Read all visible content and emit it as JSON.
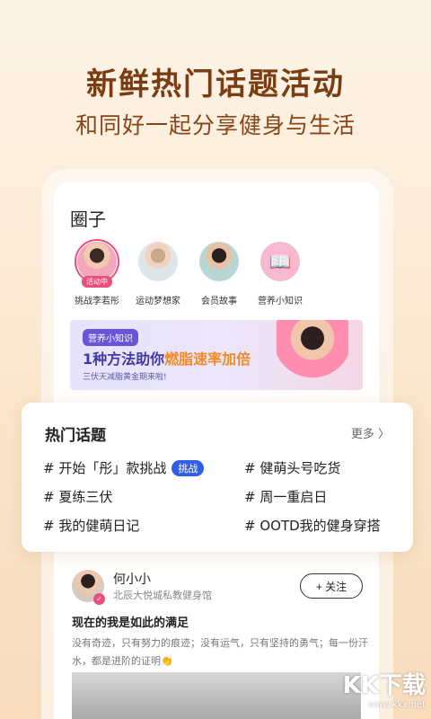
{
  "header": {
    "headline": "新鲜热门话题活动",
    "subline": "和同好一起分享健身与生活"
  },
  "circles": {
    "title": "圈子",
    "items": [
      {
        "label": "挑战李若彤",
        "badge": "活动中",
        "active": true
      },
      {
        "label": "运动梦想家"
      },
      {
        "label": "会员故事"
      },
      {
        "label": "营养小知识",
        "icon": "book-icon"
      }
    ]
  },
  "banner": {
    "tag": "营养小知识",
    "title_prefix": "1种方法助你",
    "title_highlight": "燃脂速率加倍",
    "subtitle": "三伏天减脂黄金期来啦!"
  },
  "hot_topics": {
    "title": "热门话题",
    "more": "更多 〉",
    "topics": [
      {
        "text": "# 开始「彤」款挑战",
        "badge": "挑战"
      },
      {
        "text": "# 健萌头号吃货"
      },
      {
        "text": "# 夏练三伏"
      },
      {
        "text": "# 周一重启日"
      },
      {
        "text": "# 我的健萌日记"
      },
      {
        "text": "# OOTD我的健身穿搭"
      }
    ]
  },
  "post": {
    "author": "何小小",
    "description": "北辰大悦城私教健身馆",
    "follow_label": "+ 关注",
    "title": "现在的我是如此的满足",
    "body": "没有奇迹，只有努力的痕迹；没有运气，只有坚持的勇气；每一份汗水，都是进阶的证明👏"
  },
  "watermark": {
    "main": "KK下载",
    "url": "www.kkx.net"
  },
  "colors": {
    "accent_pink": "#e94f7d",
    "challenge_badge": "#2e5fe6",
    "headline_brown": "#7a3d12"
  }
}
